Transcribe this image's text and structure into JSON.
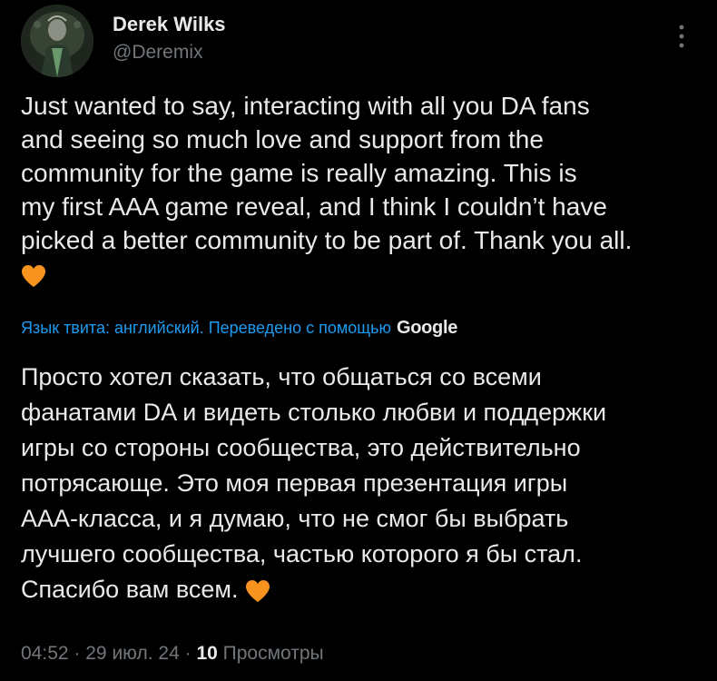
{
  "author": {
    "name": "Derek Wilks",
    "handle": "@Deremix"
  },
  "tweet": {
    "lines": [
      "Just wanted to say, interacting with all you DA fans",
      "and seeing so much love and support from the",
      "community for the game is really amazing. This is",
      "my first AAA game reveal, and I think I couldn’t have",
      "picked a better community to be part of. Thank you all."
    ],
    "emoji": "orange-heart"
  },
  "translation": {
    "label": "Язык твита: английский. Переведено с помощью",
    "provider": "Google",
    "lines": [
      "Просто хотел сказать, что общаться со всеми",
      "фанатами DA и видеть столько любви и поддержки",
      "игры со стороны сообщества, это действительно",
      "потрясающе. Это моя первая презентация игры",
      "AAA-класса, и я думаю, что не смог бы выбрать",
      "лучшего сообщества, частью которого я бы стал.",
      "Спасибо вам всем."
    ]
  },
  "meta": {
    "time": "04:52",
    "separator": "·",
    "date": "29 июл. 24",
    "views_count": "10",
    "views_label": "Просмотры"
  },
  "icons": {
    "more": "more-vertical-icon",
    "heart": "orange-heart-icon"
  },
  "colors": {
    "background": "#000000",
    "text": "#e7e9ea",
    "secondary": "#71767b",
    "link": "#1d9bf0",
    "heart": "#f7931e"
  }
}
